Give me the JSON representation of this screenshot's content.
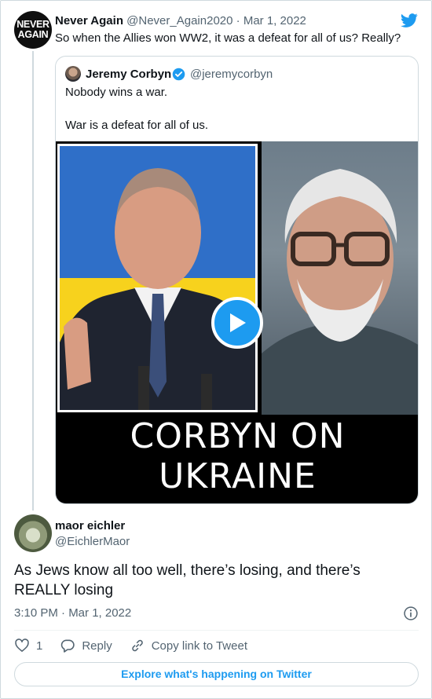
{
  "parent_tweet": {
    "avatar_lines": [
      "NEVER",
      "AGAIN"
    ],
    "display_name": "Never Again",
    "handle": "@Never_Again2020",
    "separator": " · ",
    "date": "Mar 1, 2022",
    "text": "So when the Allies won WW2, it was a defeat for all of us? Really?"
  },
  "quoted_tweet": {
    "display_name": "Jeremy Corbyn",
    "handle": "@jeremycorbyn",
    "line1": "Nobody wins a war.",
    "line2": "War is a defeat for all of us.",
    "media_caption_1": "CORBYN ON",
    "media_caption_2": "UKRAINE"
  },
  "reply": {
    "display_name": "maor eichler",
    "handle": "@EichlerMaor",
    "text": "As Jews know all too well, there’s losing, and there’s REALLY losing",
    "time": "3:10 PM · Mar 1, 2022",
    "like_count": "1",
    "reply_label": "Reply",
    "copy_label": "Copy link to Tweet"
  },
  "footer": {
    "explore_label": "Explore what's happening on Twitter"
  },
  "colors": {
    "accent": "#1d9bf0",
    "text_primary": "#0f1419",
    "text_secondary": "#536471",
    "border": "#cfd9de"
  },
  "icons": [
    "twitter-logo-icon",
    "verified-badge-icon",
    "play-icon",
    "info-icon",
    "heart-icon",
    "reply-bubble-icon",
    "link-icon"
  ]
}
